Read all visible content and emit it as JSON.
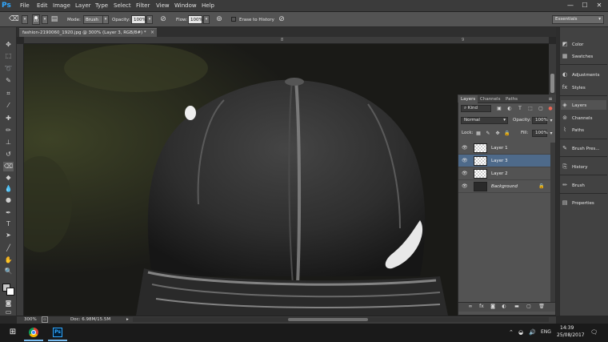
{
  "app": {
    "logo": "Ps",
    "menus": [
      "File",
      "Edit",
      "Image",
      "Layer",
      "Type",
      "Select",
      "Filter",
      "View",
      "Window",
      "Help"
    ],
    "window_controls": {
      "minimize": "—",
      "maximize": "☐",
      "close": "✕"
    }
  },
  "options": {
    "brush_size": "10",
    "mode_label": "Mode:",
    "mode_value": "Brush",
    "opacity_label": "Opacity:",
    "opacity_value": "100%",
    "flow_label": "Flow:",
    "flow_value": "100%",
    "erase_history": "Erase to History",
    "workspace": "Essentials"
  },
  "document": {
    "tab_title": "fashion-2190060_1920.jpg @ 300% (Layer 3, RGB/8#) *",
    "ruler_marks": [
      "8",
      "9"
    ],
    "zoom": "300%",
    "doc_info": "Doc: 6.98M/15.5M"
  },
  "layers_panel": {
    "tabs": [
      "Layers",
      "Channels",
      "Paths"
    ],
    "filter_kind": "Kind",
    "blend_mode": "Normal",
    "opacity_label": "Opacity:",
    "opacity_value": "100%",
    "lock_label": "Lock:",
    "fill_label": "Fill:",
    "fill_value": "100%",
    "layers": [
      {
        "name": "Layer 1",
        "selected": false,
        "background": false
      },
      {
        "name": "Layer 3",
        "selected": true,
        "background": false
      },
      {
        "name": "Layer 2",
        "selected": false,
        "background": false
      },
      {
        "name": "Background",
        "selected": false,
        "background": true
      }
    ]
  },
  "dock": {
    "items": [
      "Color",
      "Swatches",
      "Adjustments",
      "Styles",
      "Layers",
      "Channels",
      "Paths",
      "Brush Pres...",
      "History",
      "Brush",
      "Properties"
    ]
  },
  "taskbar": {
    "language": "ENG",
    "time": "14:39",
    "date": "25/08/2017"
  },
  "colors": {
    "accent_selected_layer": "#4e6a8a",
    "ps_blue": "#31a8ff"
  }
}
